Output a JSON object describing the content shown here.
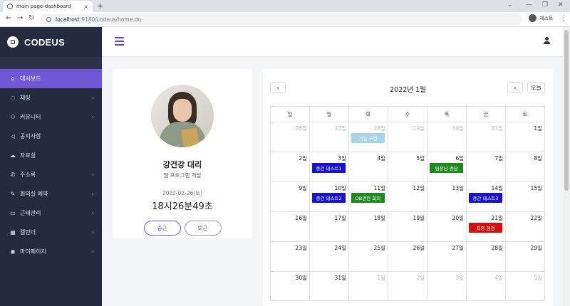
{
  "browser": {
    "tab_title": "main page-dashboard",
    "url_host": "localhost",
    "url_path": ":9180/codeus/home.do",
    "profile_label": "게스트",
    "new_tab": "+",
    "tab_close": "×",
    "minimize": "⌄",
    "win_min": "—",
    "win_max": "❐",
    "win_close": "✕",
    "back": "←",
    "forward": "→",
    "reload": "↻",
    "menu": "⋮"
  },
  "brand": {
    "name": "CODEUS"
  },
  "sidebar": {
    "items": [
      {
        "label": "대시보드",
        "icon": "home-icon",
        "glyph": "⌂",
        "active": true,
        "chevron": ""
      },
      {
        "label": "채팅",
        "icon": "chat-icon",
        "glyph": "◌",
        "active": false,
        "chevron": "›"
      },
      {
        "label": "커뮤니티",
        "icon": "users-icon",
        "glyph": "⚇",
        "active": false,
        "chevron": "›"
      },
      {
        "label": "공지사항",
        "icon": "megaphone-icon",
        "glyph": "◁",
        "active": false,
        "chevron": ""
      },
      {
        "label": "자료실",
        "icon": "cloud-icon",
        "glyph": "☁",
        "active": false,
        "chevron": ""
      },
      {
        "label": "주소록",
        "icon": "phone-icon",
        "glyph": "✆",
        "active": false,
        "chevron": "›"
      },
      {
        "label": "회의실 예약",
        "icon": "edit-icon",
        "glyph": "✎",
        "active": false,
        "chevron": "›"
      },
      {
        "label": "근태관리",
        "icon": "briefcase-icon",
        "glyph": "▭",
        "active": false,
        "chevron": "›"
      },
      {
        "label": "캘린더",
        "icon": "calendar-icon",
        "glyph": "▦",
        "active": false,
        "chevron": "›"
      },
      {
        "label": "마이페이지",
        "icon": "user-circle-icon",
        "glyph": "◉",
        "active": false,
        "chevron": "›"
      }
    ]
  },
  "profile": {
    "name": "강건강 대리",
    "department": "웹 프로그램 개발",
    "date": "2022-02-26(토)",
    "time": "18시26분49초",
    "checkin_label": "출근",
    "checkout_label": "퇴근"
  },
  "calendar": {
    "title": "2022년 1월",
    "prev": "‹",
    "next": "›",
    "today_label": "오늘",
    "weekdays": [
      "일",
      "월",
      "화",
      "수",
      "목",
      "금",
      "토"
    ],
    "weeks": [
      [
        {
          "d": "26일",
          "other": true
        },
        {
          "d": "27일",
          "other": true
        },
        {
          "d": "28일",
          "other": true,
          "event": "기능 구현",
          "color": "#a8d4ea"
        },
        {
          "d": "29일",
          "other": true
        },
        {
          "d": "30일",
          "other": true
        },
        {
          "d": "31일",
          "other": true
        },
        {
          "d": "1일"
        }
      ],
      [
        {
          "d": "2일"
        },
        {
          "d": "3일",
          "event": "중간 테스트1",
          "color": "#1a0fd6"
        },
        {
          "d": "4일"
        },
        {
          "d": "5일"
        },
        {
          "d": "6일",
          "event": "팀장님 면담",
          "color": "#1d8a1d"
        },
        {
          "d": "7일"
        },
        {
          "d": "8일"
        }
      ],
      [
        {
          "d": "9일"
        },
        {
          "d": "10일",
          "event": "중간 테스트2",
          "color": "#1a0fd6"
        },
        {
          "d": "11일",
          "event": "DB관련 회의",
          "color": "#1d8a1d"
        },
        {
          "d": "12일"
        },
        {
          "d": "13일"
        },
        {
          "d": "14일",
          "event": "중간 테스트3",
          "color": "#1a0fd6"
        },
        {
          "d": "15일"
        }
      ],
      [
        {
          "d": "16일"
        },
        {
          "d": "17일"
        },
        {
          "d": "18일"
        },
        {
          "d": "19일"
        },
        {
          "d": "20일"
        },
        {
          "d": "21일",
          "event": "최종 점검",
          "color": "#d40f0f"
        },
        {
          "d": "22일"
        }
      ],
      [
        {
          "d": "23일"
        },
        {
          "d": "24일"
        },
        {
          "d": "25일"
        },
        {
          "d": "26일"
        },
        {
          "d": "27일"
        },
        {
          "d": "28일"
        },
        {
          "d": "29일"
        }
      ],
      [
        {
          "d": "30일"
        },
        {
          "d": "31일"
        },
        {
          "d": "1일",
          "other": true
        },
        {
          "d": "2일",
          "other": true
        },
        {
          "d": "3일",
          "other": true
        },
        {
          "d": "4일",
          "other": true
        },
        {
          "d": "5일",
          "other": true
        }
      ]
    ]
  }
}
